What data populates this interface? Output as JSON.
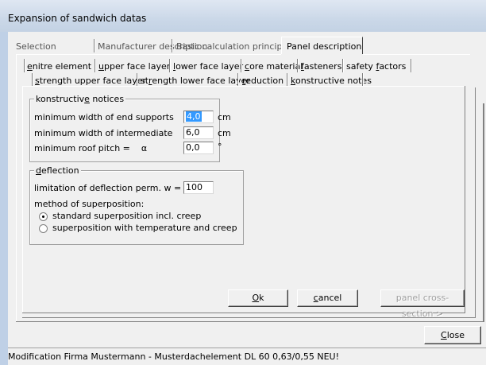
{
  "window": {
    "title": "Expansion of sandwich datas"
  },
  "main_tabs": [
    {
      "label": "Selection",
      "active": false
    },
    {
      "label": "Manufacturer description",
      "active": false
    },
    {
      "label": "Basic calculation principle",
      "active": false
    },
    {
      "label": "Panel description",
      "active": true
    }
  ],
  "sub_tabs_row1": [
    {
      "label": "enitre element",
      "mnemonic_index": 0
    },
    {
      "label": "upper face layer",
      "mnemonic_index": 0
    },
    {
      "label": "lower face layer",
      "mnemonic_index": 0
    },
    {
      "label": "core material",
      "mnemonic_index": 0
    },
    {
      "label": "fasteners",
      "mnemonic_index": 0
    },
    {
      "label": "safety factors",
      "mnemonic_index": 7
    }
  ],
  "sub_tabs_row2": [
    {
      "label": "strength upper face layer",
      "mnemonic_index": 0,
      "active": false
    },
    {
      "label": "strength lower face layer",
      "mnemonic_index": 2,
      "active": false
    },
    {
      "label": "reduction",
      "mnemonic_index": 0,
      "active": false
    },
    {
      "label": "konstructive notes",
      "mnemonic_index": 0,
      "active": true
    }
  ],
  "constructive_notices": {
    "group_title": "konstructive notices",
    "group_title_mnemonic_index": 11,
    "rows": [
      {
        "label": "minimum width of end supports",
        "value": "4,0",
        "unit": "cm",
        "selected": true
      },
      {
        "label": "minimum width of intermediate",
        "value": "6,0",
        "unit": "cm",
        "selected": false
      },
      {
        "label": "minimum roof pitch =    α",
        "value": "0,0",
        "unit": "°",
        "selected": false
      }
    ]
  },
  "deflection": {
    "group_title": "deflection",
    "limit_label": "limitation of deflection perm. w =",
    "limit_value": "100",
    "method_label": "method of superposition:",
    "options": [
      {
        "label": "standard superposition incl. creep",
        "checked": true
      },
      {
        "label": "superposition with temperature and creep",
        "checked": false
      }
    ]
  },
  "inner_buttons": {
    "ok": "Ok",
    "cancel": "cancel",
    "cross_section": "panel cross-section >"
  },
  "close_button": "Close",
  "status_text": "Modification Firma Mustermann - Musterdachelement DL 60 0,63/0,55 NEU!"
}
